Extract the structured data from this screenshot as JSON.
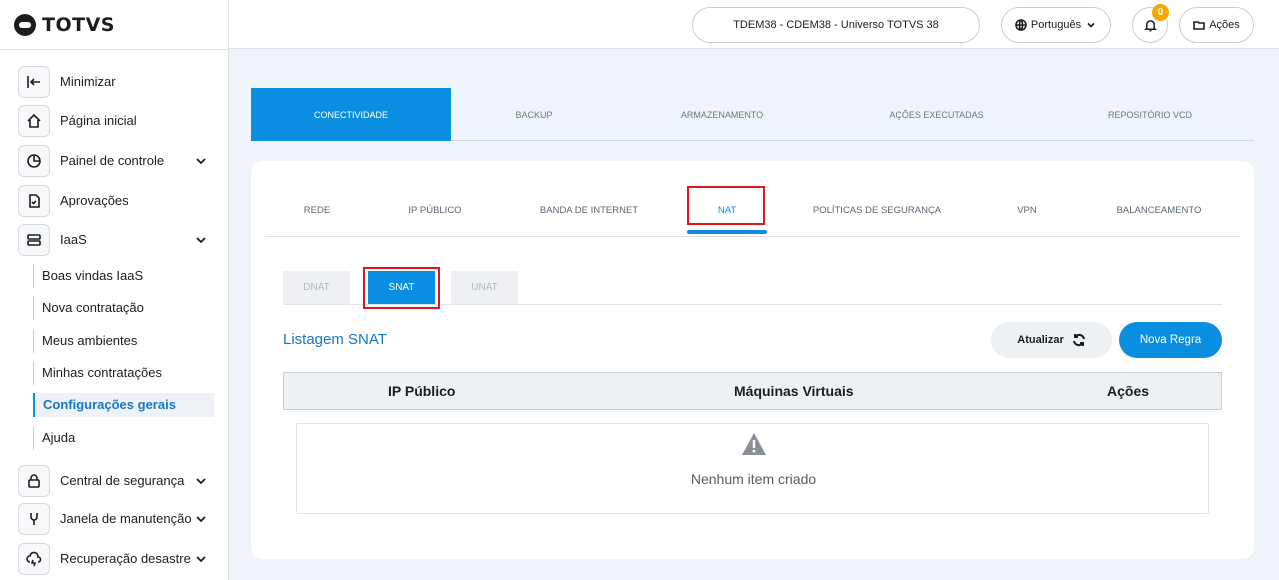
{
  "brand": {
    "name": "TOTVS"
  },
  "sidebar": {
    "items": [
      {
        "label": "Minimizar",
        "icon": "collapse-left-icon"
      },
      {
        "label": "Página inicial",
        "icon": "home-icon"
      },
      {
        "label": "Painel de controle",
        "icon": "pie-chart-icon"
      },
      {
        "label": "Aprovações",
        "icon": "document-check-icon"
      },
      {
        "label": "IaaS",
        "icon": "server-icon"
      },
      {
        "label": "Central de segurança",
        "icon": "lock-icon"
      },
      {
        "label": "Janela de manutenção",
        "icon": "wrench-icon"
      },
      {
        "label": "Recuperação desastre",
        "icon": "cloud-sync-icon"
      }
    ],
    "iaas_sub": [
      {
        "label": "Boas vindas IaaS"
      },
      {
        "label": "Nova contratação"
      },
      {
        "label": "Meus ambientes"
      },
      {
        "label": "Minhas contratações"
      },
      {
        "label": "Configurações gerais",
        "active": true
      },
      {
        "label": "Ajuda"
      }
    ]
  },
  "header": {
    "environment": "TDEM38 - CDEM38 - Universo TOTVS 38",
    "language": "Português",
    "notification_count": "0",
    "actions_label": "Ações"
  },
  "top_tabs": [
    "CONECTIVIDADE",
    "BACKUP",
    "ARMAZENAMENTO",
    "AÇÕES EXECUTADAS",
    "REPOSITÓRIO VCD"
  ],
  "active_top_tab": "CONECTIVIDADE",
  "sub_tabs": [
    "REDE",
    "IP PÚBLICO",
    "BANDA DE INTERNET",
    "NAT",
    "POLÍTICAS DE SEGURANÇA",
    "VPN",
    "BALANCEAMENTO"
  ],
  "active_sub_tab": "NAT",
  "nat_tabs": [
    "DNAT",
    "SNAT",
    "UNAT"
  ],
  "active_nat_tab": "SNAT",
  "listing": {
    "title": "Listagem SNAT",
    "refresh_label": "Atualizar",
    "new_rule_label": "Nova Regra",
    "columns": [
      "IP Público",
      "Máquinas Virtuais",
      "Ações"
    ],
    "empty_message": "Nenhum item criado"
  },
  "colors": {
    "accent": "#0a8fe0",
    "highlight": "#e0161a",
    "badge": "#f5a800"
  }
}
